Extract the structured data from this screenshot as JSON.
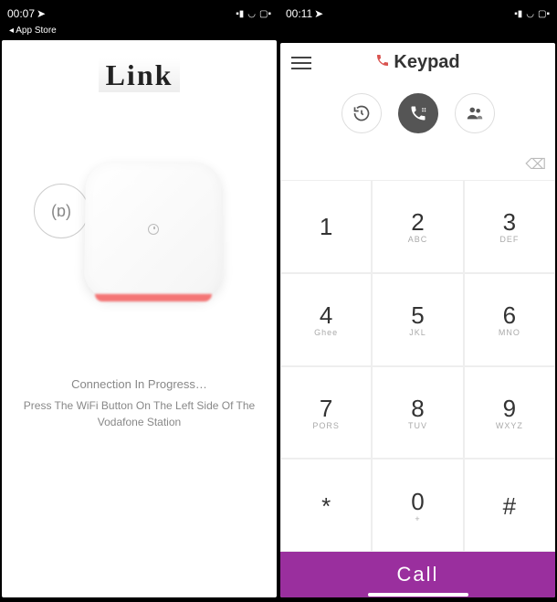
{
  "left_screen": {
    "status": {
      "time": "00:07",
      "back_label": "App Store"
    },
    "title": "Link",
    "wifi_symbol": "((o))",
    "connection": {
      "progress": "Connection In Progress…",
      "instruction": "Press The WiFi Button On The Left Side Of The Vodafone Station"
    }
  },
  "right_screen": {
    "status": {
      "time": "00:11"
    },
    "title": "Keypad",
    "keys": [
      {
        "num": "1",
        "sub": ""
      },
      {
        "num": "2",
        "sub": "ABC"
      },
      {
        "num": "3",
        "sub": "DEF"
      },
      {
        "num": "4",
        "sub": "Ghee"
      },
      {
        "num": "5",
        "sub": "JKL"
      },
      {
        "num": "6",
        "sub": "MNO"
      },
      {
        "num": "7",
        "sub": "PORS"
      },
      {
        "num": "8",
        "sub": "TUV"
      },
      {
        "num": "9",
        "sub": "WXYZ"
      },
      {
        "num": "*",
        "sub": ""
      },
      {
        "num": "0",
        "sub": "+"
      },
      {
        "num": "#",
        "sub": ""
      }
    ],
    "call_label": "Call"
  }
}
